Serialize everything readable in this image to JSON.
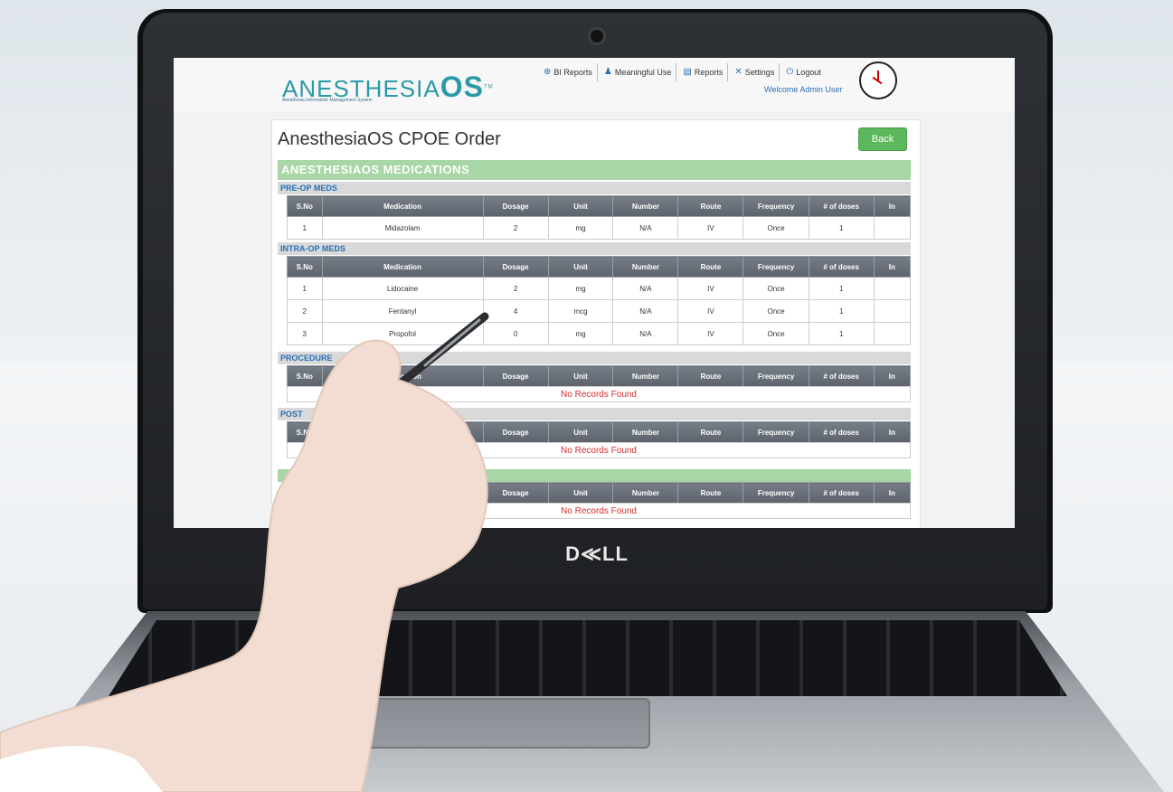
{
  "brand": {
    "laptop": "D≪LL"
  },
  "app": {
    "logo_main": "ANESTHESIA",
    "logo_os": "OS",
    "logo_tm": "TM",
    "tagline": "Anesthesia Information Management System",
    "welcome": "Welcome  Admin User"
  },
  "nav": {
    "items": [
      {
        "label": "BI Reports",
        "icon": "bi-reports-icon"
      },
      {
        "label": "Meaningful Use",
        "icon": "users-icon"
      },
      {
        "label": "Reports",
        "icon": "reports-icon"
      },
      {
        "label": "Settings",
        "icon": "settings-icon"
      },
      {
        "label": "Logout",
        "icon": "power-icon"
      }
    ]
  },
  "page": {
    "title": "AnesthesiaOS CPOE Order",
    "back_label": "Back",
    "band_title": "ANESTHESIAOS MEDICATIONS"
  },
  "columns": [
    "S.No",
    "Medication",
    "Dosage",
    "Unit",
    "Number",
    "Route",
    "Frequency",
    "# of doses",
    "In"
  ],
  "sections": {
    "preop": {
      "title": "PRE-OP MEDS",
      "rows": [
        [
          "1",
          "Midazolam",
          "2",
          "mg",
          "N/A",
          "IV",
          "Once",
          "1",
          ""
        ]
      ]
    },
    "intraop": {
      "title": "INTRA-OP MEDS",
      "rows": [
        [
          "1",
          "Lidocaine",
          "2",
          "mg",
          "N/A",
          "IV",
          "Once",
          "1",
          ""
        ],
        [
          "2",
          "Fentanyl",
          "4",
          "mcg",
          "N/A",
          "IV",
          "Once",
          "1",
          ""
        ],
        [
          "3",
          "Propofol",
          "0",
          "mg",
          "N/A",
          "IV",
          "Once",
          "1",
          ""
        ]
      ]
    },
    "procedure": {
      "title": "PROCEDURE",
      "empty": "No Records Found"
    },
    "postop": {
      "title": "POST",
      "empty": "No Records Found"
    },
    "other": {
      "empty": "No Records Found"
    }
  }
}
